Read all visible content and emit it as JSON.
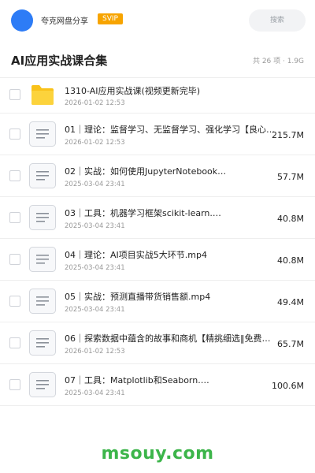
{
  "header": {
    "user_name": "夸克网盘分享",
    "badge": "SVIP",
    "search_placeholder": "搜索",
    "colors": {
      "avatar": "#2d7cf6",
      "badge": "#f7a400"
    }
  },
  "folder": {
    "title": "AI应用实战课合集",
    "meta": "共 26 项 · 1.9G"
  },
  "files": [
    {
      "type": "folder",
      "icon": "folder-icon",
      "name": "1310-AI应用实战课(视频更新完毕)",
      "date": "2026-01-02 12:53",
      "size": ""
    },
    {
      "type": "file",
      "icon": "document-icon",
      "name": "01｜理论：监督学习、无监督学习、强化学习【良心整…",
      "date": "2026-01-02 12:53",
      "size": "215.7M"
    },
    {
      "type": "file",
      "icon": "document-icon",
      "name": "02｜实战：如何使用JupyterNotebook…",
      "date": "2025-03-04 23:41",
      "size": "57.7M"
    },
    {
      "type": "file",
      "icon": "document-icon",
      "name": "03｜工具：机器学习框架scikit-learn.…",
      "date": "2025-03-04 23:41",
      "size": "40.8M"
    },
    {
      "type": "file",
      "icon": "document-icon",
      "name": "04｜理论：AI项目实战5大环节.mp4",
      "date": "2025-03-04 23:41",
      "size": "40.8M"
    },
    {
      "type": "file",
      "icon": "document-icon",
      "name": "05｜实战：预测直播带货销售额.mp4",
      "date": "2025-03-04 23:41",
      "size": "49.4M"
    },
    {
      "type": "file",
      "icon": "document-icon",
      "name": "06｜探索数据中蕴含的故事和商机【精挑细选‖免费提…",
      "date": "2026-01-02 12:53",
      "size": "65.7M"
    },
    {
      "type": "file",
      "icon": "document-icon",
      "name": "07｜工具：Matplotlib和Seaborn.…",
      "date": "2025-03-04 23:41",
      "size": "100.6M"
    }
  ],
  "watermark": {
    "text": "msouy.com",
    "color": "#3cb54a"
  }
}
